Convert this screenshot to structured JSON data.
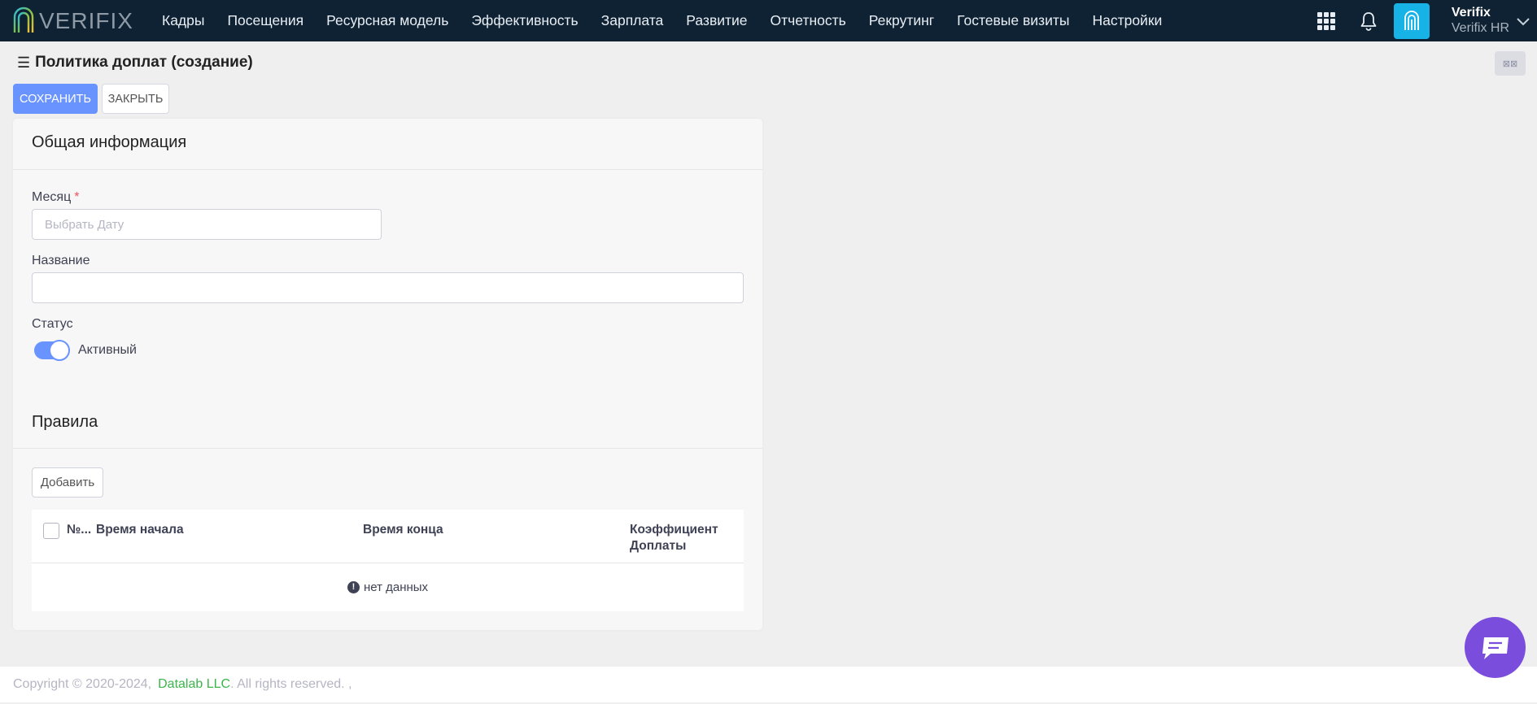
{
  "app": {
    "logo_text": "VERIFIX",
    "user_name": "Verifix",
    "user_org": "Verifix HR"
  },
  "nav": {
    "items": [
      {
        "label": "Кадры"
      },
      {
        "label": "Посещения"
      },
      {
        "label": "Ресурсная модель"
      },
      {
        "label": "Эффективность"
      },
      {
        "label": "Зарплата"
      },
      {
        "label": "Развитие"
      },
      {
        "label": "Отчетность"
      },
      {
        "label": "Рекрутинг"
      },
      {
        "label": "Гостевые визиты"
      },
      {
        "label": "Настройки"
      }
    ]
  },
  "page": {
    "title": "Политика доплат (создание)",
    "save_label": "СОХРАНИТЬ",
    "close_label": "ЗАКРЫТЬ",
    "top_right_glyph": "⊠⊠"
  },
  "general": {
    "section_title": "Общая информация",
    "month_label": "Месяц",
    "month_required": "*",
    "month_placeholder": "Выбрать Дату",
    "name_label": "Название",
    "name_value": "",
    "status_label": "Статус",
    "status_value": "Активный"
  },
  "rules": {
    "section_title": "Правила",
    "add_label": "Добавить",
    "columns": {
      "num": "№...",
      "start": "Время начала",
      "end": "Время конца",
      "coef_line1": "Коэффициент",
      "coef_line2": "Доплаты"
    },
    "empty_text": "нет данных"
  },
  "footer": {
    "copyright": "Copyright © 2020-2024,",
    "company": "Datalab LLC",
    "rights": ". All rights reserved. ,"
  },
  "colors": {
    "nav_bg": "#0f2233",
    "primary": "#6993ff",
    "chat": "#7b4ddd",
    "avatar": "#17b3e6"
  }
}
